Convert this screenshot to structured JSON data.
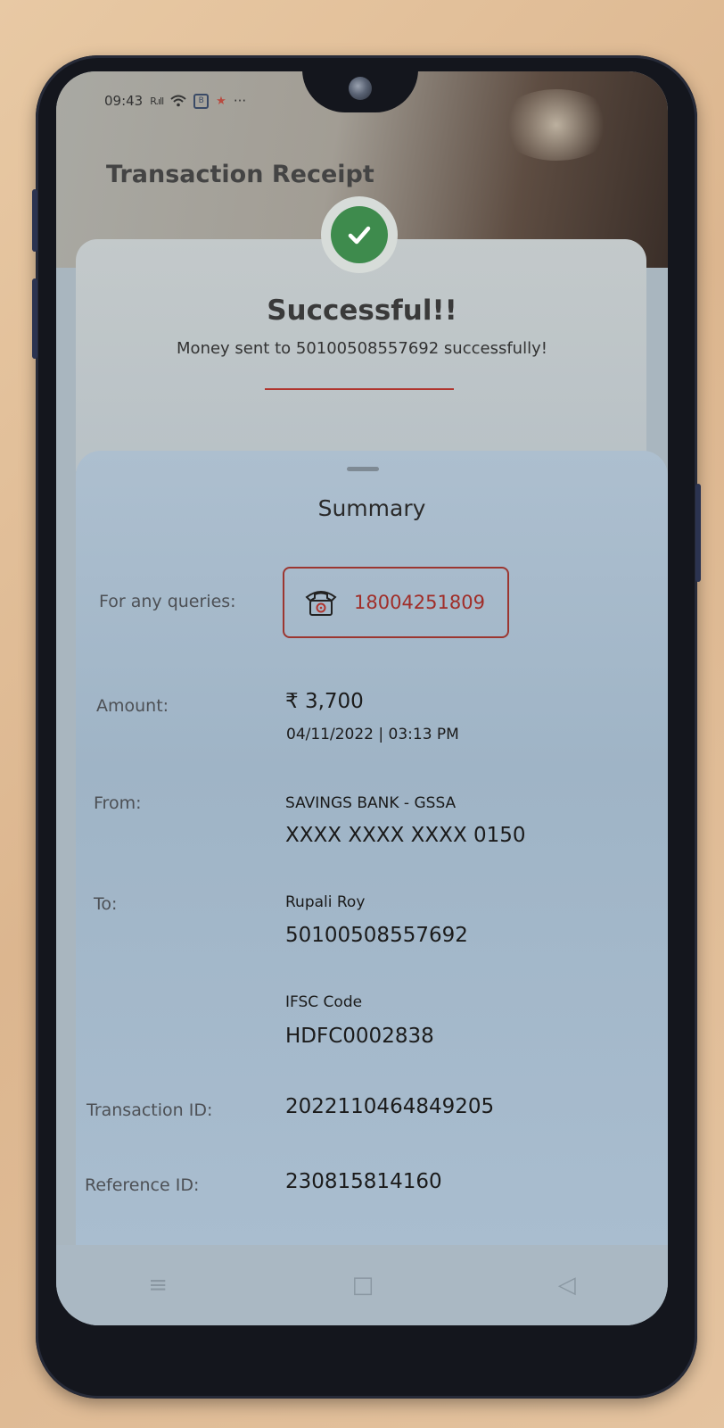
{
  "status_bar": {
    "time": "09:43",
    "signal": "R.ıll",
    "wifi_icon": "wifi-icon",
    "app_icon_1": "B",
    "more": "···"
  },
  "header": {
    "title": "Transaction Receipt"
  },
  "result": {
    "title": "Successful!!",
    "message": "Money sent to 50100508557692 successfully!",
    "status_color": "#3e8b4d"
  },
  "summary": {
    "title": "Summary",
    "queries_label": "For any queries:",
    "queries_phone": "18004251809",
    "amount_label": "Amount:",
    "amount_value": "₹ 3,700",
    "datetime": "04/11/2022 | 03:13 PM",
    "from_label": "From:",
    "from_account_type": "SAVINGS BANK - GSSA",
    "from_account_number": "XXXX XXXX XXXX 0150",
    "to_label": "To:",
    "to_name": "Rupali Roy",
    "to_account_number": "50100508557692",
    "ifsc_label": "IFSC Code",
    "ifsc_value": "HDFC0002838",
    "transaction_id_label": "Transaction ID:",
    "transaction_id_value": "2022110464849205",
    "reference_id_label": "Reference ID:",
    "reference_id_value": "230815814160"
  },
  "colors": {
    "accent_red": "#a02d28",
    "success_green": "#3e8b4d"
  },
  "nav": {
    "menu_icon": "≡",
    "home_icon": "□",
    "back_icon": "◁"
  }
}
